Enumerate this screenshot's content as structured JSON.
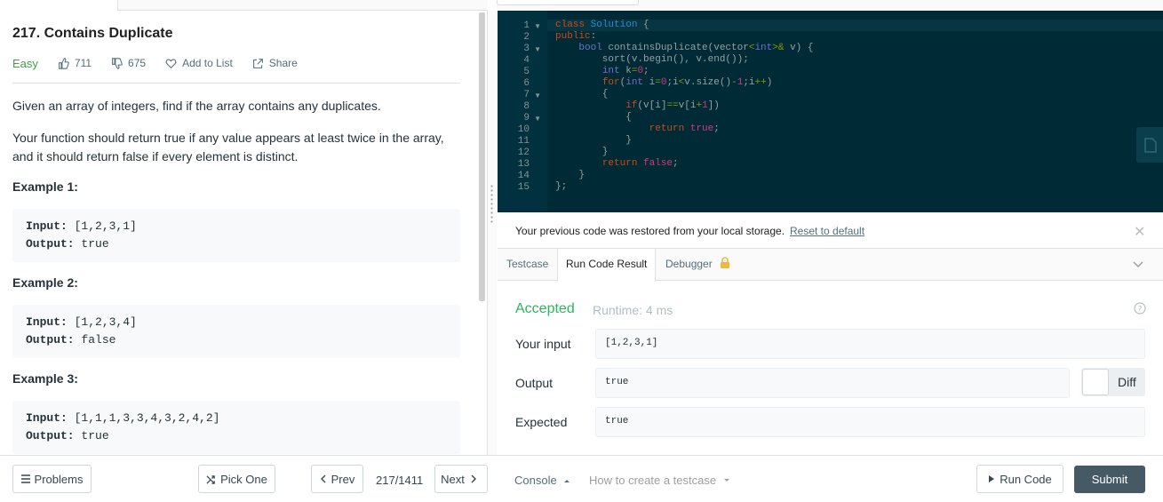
{
  "problem": {
    "title": "217. Contains Duplicate",
    "difficulty": "Easy",
    "likes": "711",
    "dislikes": "675",
    "add_to_list": "Add to List",
    "share": "Share",
    "description_1": "Given an array of integers, find if the array contains any duplicates.",
    "description_2": "Your function should return true if any value appears at least twice in the array, and it should return false if every element is distinct.",
    "examples": [
      {
        "heading": "Example 1:",
        "input_label": "Input:",
        "input": " [1,2,3,1]",
        "output_label": "Output:",
        "output": " true"
      },
      {
        "heading": "Example 2:",
        "input_label": "Input:",
        "input": " [1,2,3,4]",
        "output_label": "Output:",
        "output": " false"
      },
      {
        "heading": "Example 3:",
        "input_label": "Input:",
        "input": " [1,1,1,3,3,4,3,2,4,2]",
        "output_label": "Output:",
        "output": " true"
      }
    ]
  },
  "editor": {
    "line_numbers": [
      "1",
      "2",
      "3",
      "4",
      "5",
      "6",
      "7",
      "8",
      "9",
      "10",
      "11",
      "12",
      "13",
      "14",
      "15"
    ]
  },
  "restore": {
    "message": "Your previous code was restored from your local storage.",
    "reset_link": "Reset to default"
  },
  "tabs": {
    "testcase": "Testcase",
    "run_code_result": "Run Code Result",
    "debugger": "Debugger"
  },
  "result": {
    "status": "Accepted",
    "runtime": "Runtime: 4 ms",
    "your_input_label": "Your input",
    "your_input": "[1,2,3,1]",
    "output_label": "Output",
    "output": "true",
    "expected_label": "Expected",
    "expected": "true",
    "diff_label": "Diff"
  },
  "bottom": {
    "problems": "Problems",
    "pick_one": "Pick One",
    "prev": "Prev",
    "pager": "217/1411",
    "next": "Next",
    "console": "Console",
    "howto": "How to create a testcase",
    "run_code": "Run Code",
    "submit": "Submit"
  },
  "colors": {
    "accepted": "#2db55d",
    "easy": "#43a047",
    "editor_bg": "#002b36",
    "submit_bg": "#455a64"
  }
}
